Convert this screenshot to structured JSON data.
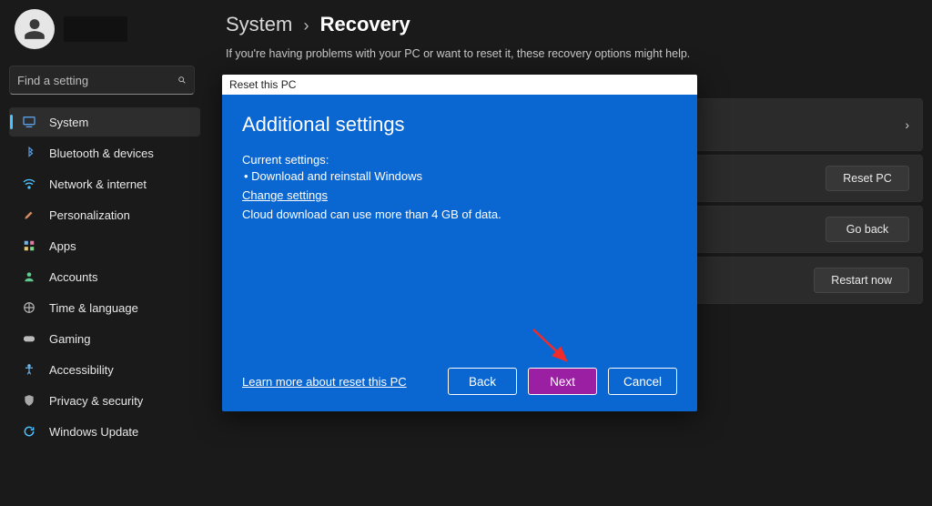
{
  "user": {
    "name": ""
  },
  "search": {
    "placeholder": "Find a setting"
  },
  "nav": {
    "items": [
      {
        "label": "System"
      },
      {
        "label": "Bluetooth & devices"
      },
      {
        "label": "Network & internet"
      },
      {
        "label": "Personalization"
      },
      {
        "label": "Apps"
      },
      {
        "label": "Accounts"
      },
      {
        "label": "Time & language"
      },
      {
        "label": "Gaming"
      },
      {
        "label": "Accessibility"
      },
      {
        "label": "Privacy & security"
      },
      {
        "label": "Windows Update"
      }
    ]
  },
  "breadcrumb": {
    "root": "System",
    "sep": "›",
    "page": "Recovery"
  },
  "page_subtext": "If you're having problems with your PC or want to reset it, these recovery options might help.",
  "cards": {
    "reset_label": "Reset PC",
    "goback_label": "Go back",
    "restart_label": "Restart now"
  },
  "modal": {
    "titlebar": "Reset this PC",
    "heading": "Additional settings",
    "current_label": "Current settings:",
    "bullet1": "•  Download and reinstall Windows",
    "change_link": "Change settings",
    "note": "Cloud download can use more than 4 GB of data.",
    "learn_link": "Learn more about reset this PC",
    "back": "Back",
    "next": "Next",
    "cancel": "Cancel"
  }
}
